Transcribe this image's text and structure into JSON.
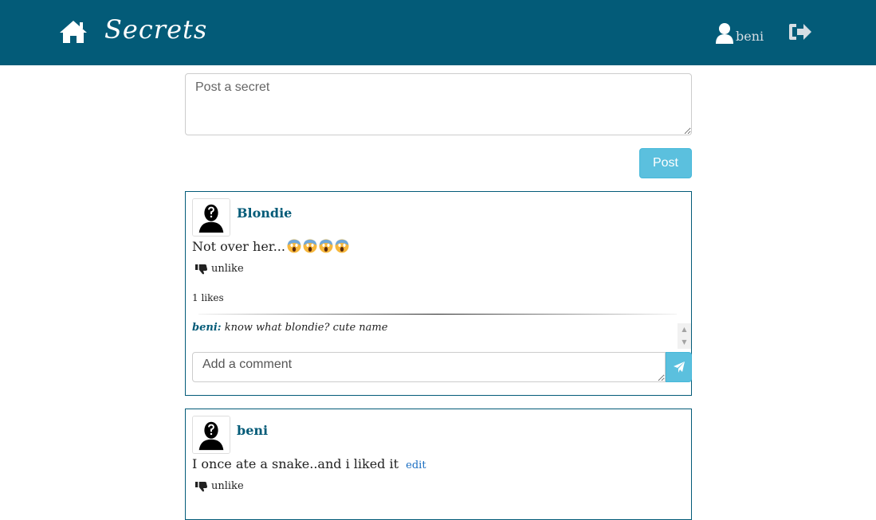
{
  "header": {
    "brand": "Secrets",
    "user_name": "beni",
    "icons": [
      "home-icon",
      "user-icon",
      "logout-icon"
    ]
  },
  "post_form": {
    "placeholder": "Post a secret",
    "post_label": "Post"
  },
  "posts": [
    {
      "author": "Blondie",
      "text": "Not over her...",
      "emoji": [
        "😱",
        "😱",
        "😱",
        "😱"
      ],
      "unlike_label": "unlike",
      "likes_text": "1 likes",
      "comments": [
        {
          "author": "beni:",
          "text": "know what blondie? cute name"
        }
      ],
      "comment_placeholder": "Add a comment"
    },
    {
      "author": "beni",
      "text": "I once ate a snake..and i liked it",
      "edit_label": "edit",
      "unlike_label": "unlike"
    }
  ],
  "colors": {
    "header_bg": "#035b78",
    "accent": "#5bc0de",
    "author": "#035b78",
    "link": "#1a6ec2"
  }
}
